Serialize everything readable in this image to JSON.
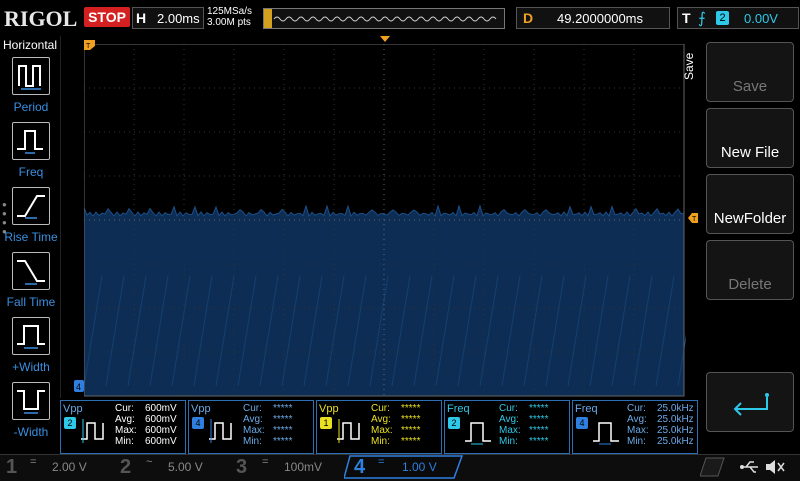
{
  "brand": "RIGOL",
  "run_state": "STOP",
  "horizontal": {
    "label": "H",
    "scale": "2.00ms"
  },
  "acquisition": {
    "sample_rate": "125MSa/s",
    "memory": "3.00M pts"
  },
  "delay": {
    "label": "D",
    "value": "49.2000000ms"
  },
  "trigger": {
    "label": "T",
    "edge_icon": "rising-edge-icon",
    "source": "2",
    "level": "0.00V"
  },
  "sidebar": {
    "title": "Horizontal",
    "items": [
      {
        "label": "Period",
        "icon": "period-icon"
      },
      {
        "label": "Freq",
        "icon": "freq-icon"
      },
      {
        "label": "Rise Time",
        "icon": "rise-time-icon"
      },
      {
        "label": "Fall Time",
        "icon": "fall-time-icon"
      },
      {
        "label": "+Width",
        "icon": "pos-width-icon"
      },
      {
        "label": "-Width",
        "icon": "neg-width-icon"
      }
    ]
  },
  "save_menu": {
    "title": "Save",
    "buttons": [
      {
        "label": "Save",
        "enabled": false
      },
      {
        "label": "New File",
        "enabled": true
      },
      {
        "label": "NewFolder",
        "enabled": true
      },
      {
        "label": "Delete",
        "enabled": false
      },
      {
        "label": "",
        "icon": "enter-icon",
        "enabled": true
      }
    ]
  },
  "measurements": [
    {
      "name": "Vpp",
      "channel": "2",
      "cur": "600mV",
      "avg": "600mV",
      "max": "600mV",
      "min": "600mV"
    },
    {
      "name": "Vpp",
      "channel": "4",
      "cur": "*****",
      "avg": "*****",
      "max": "*****",
      "min": "*****"
    },
    {
      "name": "Vpp",
      "channel": "1",
      "cur": "*****",
      "avg": "*****",
      "max": "*****",
      "min": "*****"
    },
    {
      "name": "Freq",
      "channel": "2",
      "cur": "*****",
      "avg": "*****",
      "max": "*****",
      "min": "*****"
    },
    {
      "name": "Freq",
      "channel": "4",
      "cur": "25.0kHz",
      "avg": "25.0kHz",
      "max": "25.0kHz",
      "min": "25.0kHz"
    }
  ],
  "measure_keys": {
    "cur": "Cur:",
    "avg": "Avg:",
    "max": "Max:",
    "min": "Min:"
  },
  "channels": [
    {
      "num": "1",
      "coupling": "=",
      "scale": "2.00 V",
      "color": "#e8e020",
      "active": false
    },
    {
      "num": "2",
      "coupling": "~",
      "scale": "5.00 V",
      "color": "#2ec8e8",
      "active": false
    },
    {
      "num": "3",
      "coupling": "=",
      "scale": "100mV",
      "color": "#d040d0",
      "active": false
    },
    {
      "num": "4",
      "coupling": "=",
      "scale": "1.00 V",
      "color": "#2e7fe0",
      "active": true
    }
  ],
  "colors": {
    "ch1": "#e8e020",
    "ch2": "#2ec8e8",
    "ch3": "#d040d0",
    "ch4": "#2e7fe0",
    "delay": "#f0a020",
    "stop": "#d42020"
  }
}
